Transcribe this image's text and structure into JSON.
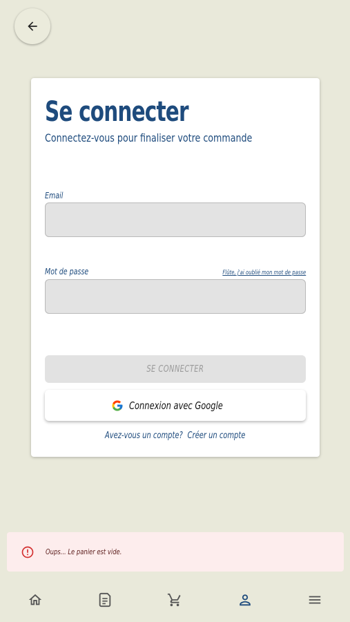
{
  "page": {
    "title": "Se connecter",
    "subtitle": "Connectez-vous pour finaliser votre commande"
  },
  "form": {
    "email_label": "Email",
    "email_value": "",
    "password_label": "Mot de passe",
    "password_value": "",
    "forgot_link": "Flûte, j'ai oublié mon mot de passe",
    "login_button": "SE CONNECTER",
    "google_button": "Connexion avec Google",
    "account_question": "Avez-vous un compte?",
    "create_account_link": "Créer un compte"
  },
  "toast": {
    "message": "Oups... Le panier est vide.",
    "icon": "error-circle-icon"
  },
  "nav": {
    "items": [
      {
        "icon": "home-icon",
        "active": false
      },
      {
        "icon": "receipt-icon",
        "active": false
      },
      {
        "icon": "cart-icon",
        "active": false
      },
      {
        "icon": "person-icon",
        "active": true
      },
      {
        "icon": "menu-icon",
        "active": false
      }
    ]
  },
  "colors": {
    "background": "#e9e9da",
    "primary": "#1e4b7d",
    "error": "#d32f2f",
    "toast_bg": "#fdeded",
    "nav_inactive": "#555555"
  }
}
